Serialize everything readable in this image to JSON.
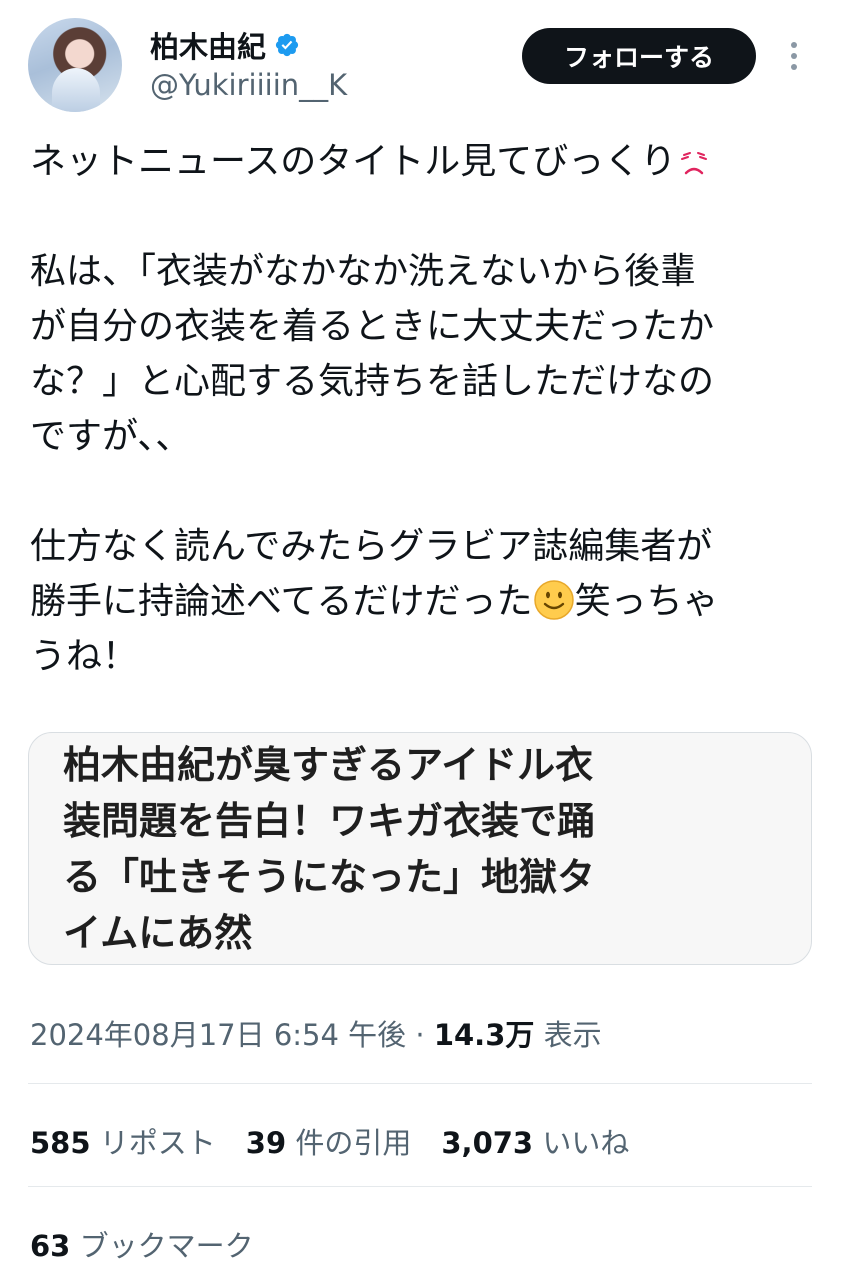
{
  "author": {
    "display_name": "柏木由紀",
    "handle": "@Yukiriiiin__K",
    "verified": true,
    "avatar_icon": "profile-photo"
  },
  "actions": {
    "follow_label": "フォローする",
    "more_icon": "more-dots-icon"
  },
  "tweet": {
    "lines": [
      "ネットニュースのタイトル見てびっくり",
      "私は、「衣装がなかなか洗えないから後輩",
      "が自分の衣装を着るときに大丈夫だったか",
      "な？」と心配する気持ちを話しただけなの",
      "ですが、、",
      "仕方なく読んでみたらグラビア誌編集者が",
      "勝手に持論述べてるだけだった",
      "笑っちゃ",
      "うね！"
    ],
    "emojis": [
      "frowning-face-emoji",
      "smiling-face-emoji"
    ]
  },
  "quote_card": {
    "lines": [
      "柏木由紀が臭すぎるアイドル衣",
      "装問題を告白！ワキガ衣装で踊",
      "る「吐きそうになった」地獄タ",
      "イムにあ然"
    ]
  },
  "meta": {
    "timestamp": "2024年08月17日 6:54 午後",
    "separator": "·",
    "views_count": "14.3万",
    "views_label": "表示"
  },
  "stats": {
    "reposts_count": "585",
    "reposts_label": "リポスト",
    "quotes_count": "39",
    "quotes_label": "件の引用",
    "likes_count": "3,073",
    "likes_label": "いいね",
    "bookmarks_count": "63",
    "bookmarks_label": "ブックマーク"
  },
  "colors": {
    "text_primary": "#0f1419",
    "text_secondary": "#536471",
    "verified_blue": "#1d9bf0",
    "follow_button_bg": "#0f1419"
  }
}
